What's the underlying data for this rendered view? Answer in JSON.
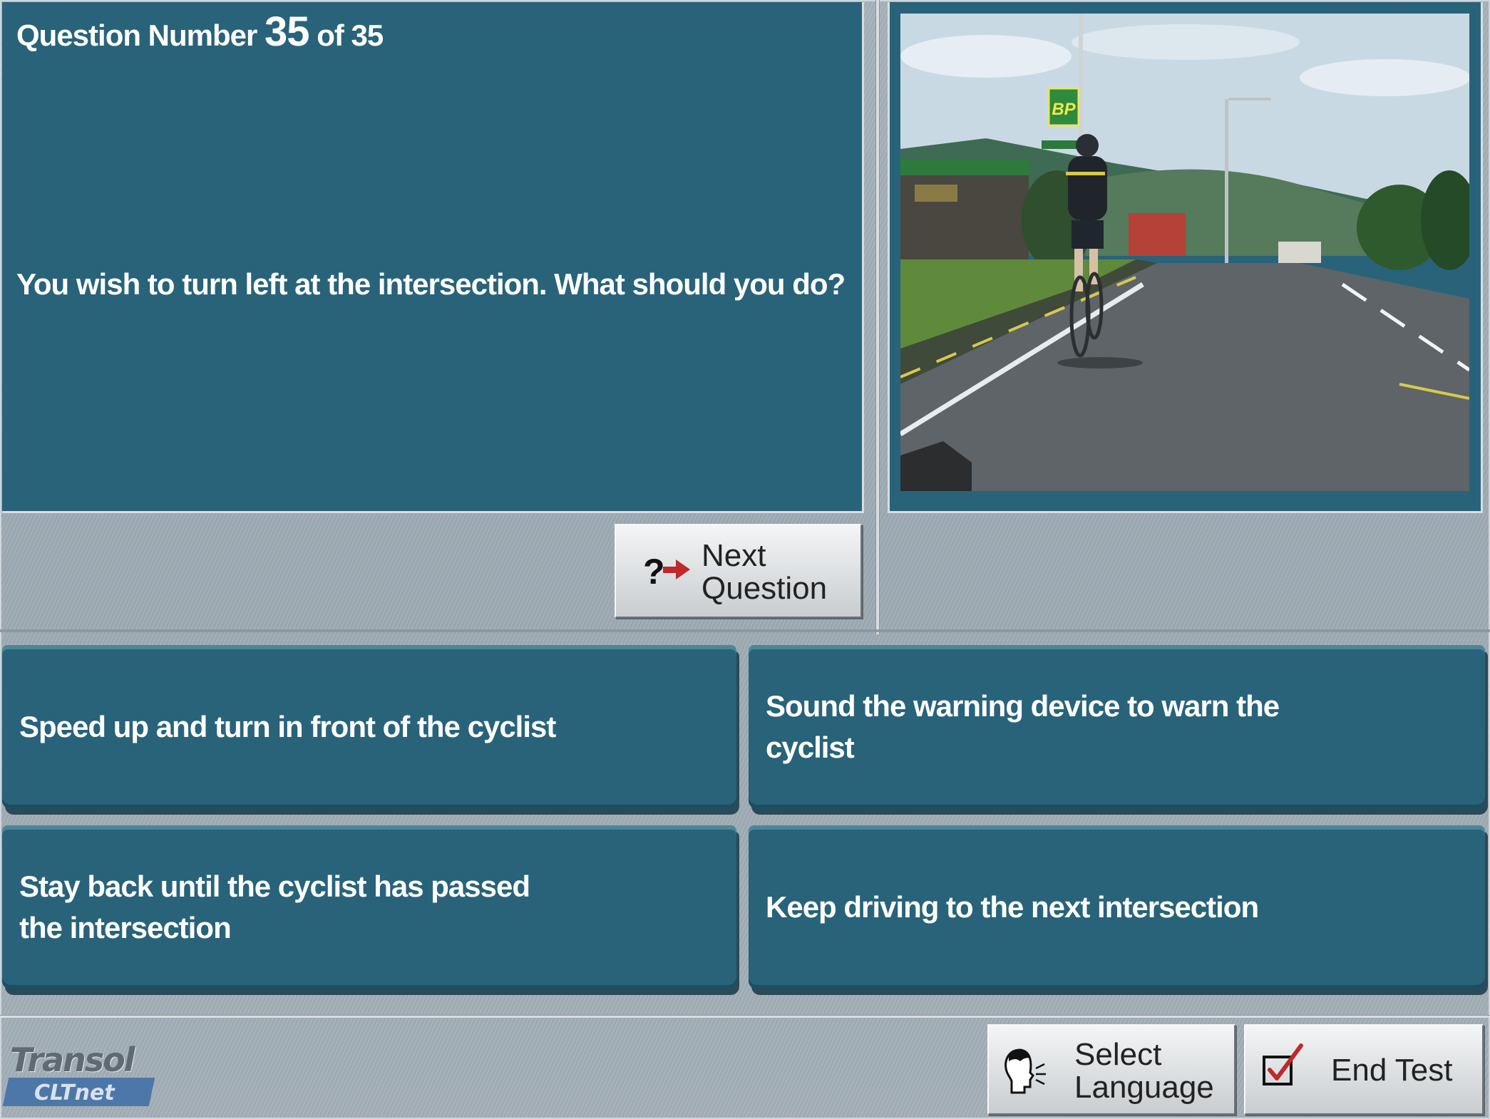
{
  "question": {
    "prefix": "Question Number",
    "number": "35",
    "of_label": "of 35",
    "text": "You wish to turn left at the intersection. What should you do?"
  },
  "image": {
    "sign_text": "BP"
  },
  "next_button": {
    "line1": "Next",
    "line2": "Question",
    "icon": "question-arrow-icon"
  },
  "answers": [
    {
      "text": "Speed up and turn in front of the cyclist"
    },
    {
      "text": "Sound the warning device to warn the cyclist"
    },
    {
      "text": "Stay back until the cyclist has passed the intersection"
    },
    {
      "text": "Keep driving to the next intersection"
    }
  ],
  "footer": {
    "logo_top": "Transol",
    "logo_bottom": "CLTnet",
    "select_language": {
      "line1": "Select",
      "line2": "Language",
      "icon": "speaking-head-icon"
    },
    "end_test": {
      "label": "End Test",
      "icon": "checkbox-check-icon"
    }
  },
  "colors": {
    "panel": "#28637a",
    "background": "#a4b0b8",
    "arrow_red": "#c0282a"
  }
}
